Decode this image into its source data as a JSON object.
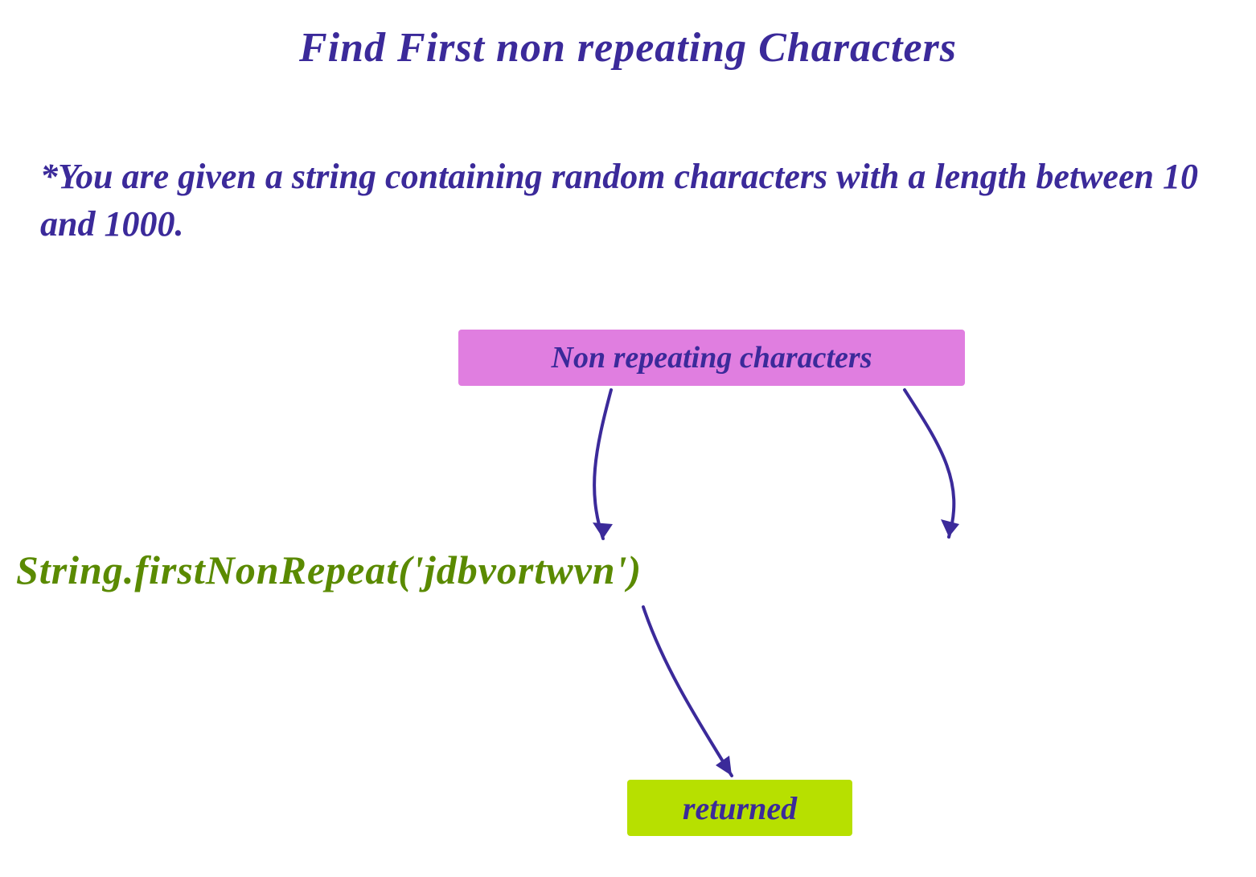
{
  "title": "Find First non repeating Characters",
  "description": "*You are given a string containing random characters with a length between 10 and 1000.",
  "labels": {
    "non_repeating": "Non repeating characters",
    "returned": "returned"
  },
  "example": {
    "prefix": "String.firstNonRepeat(",
    "argument": "'jdbvortwvn'",
    "suffix": ")"
  },
  "colors": {
    "text": "#3b2a9a",
    "code": "#5a8a00",
    "pill_pink": "#e07ee0",
    "pill_green": "#b7e000"
  }
}
